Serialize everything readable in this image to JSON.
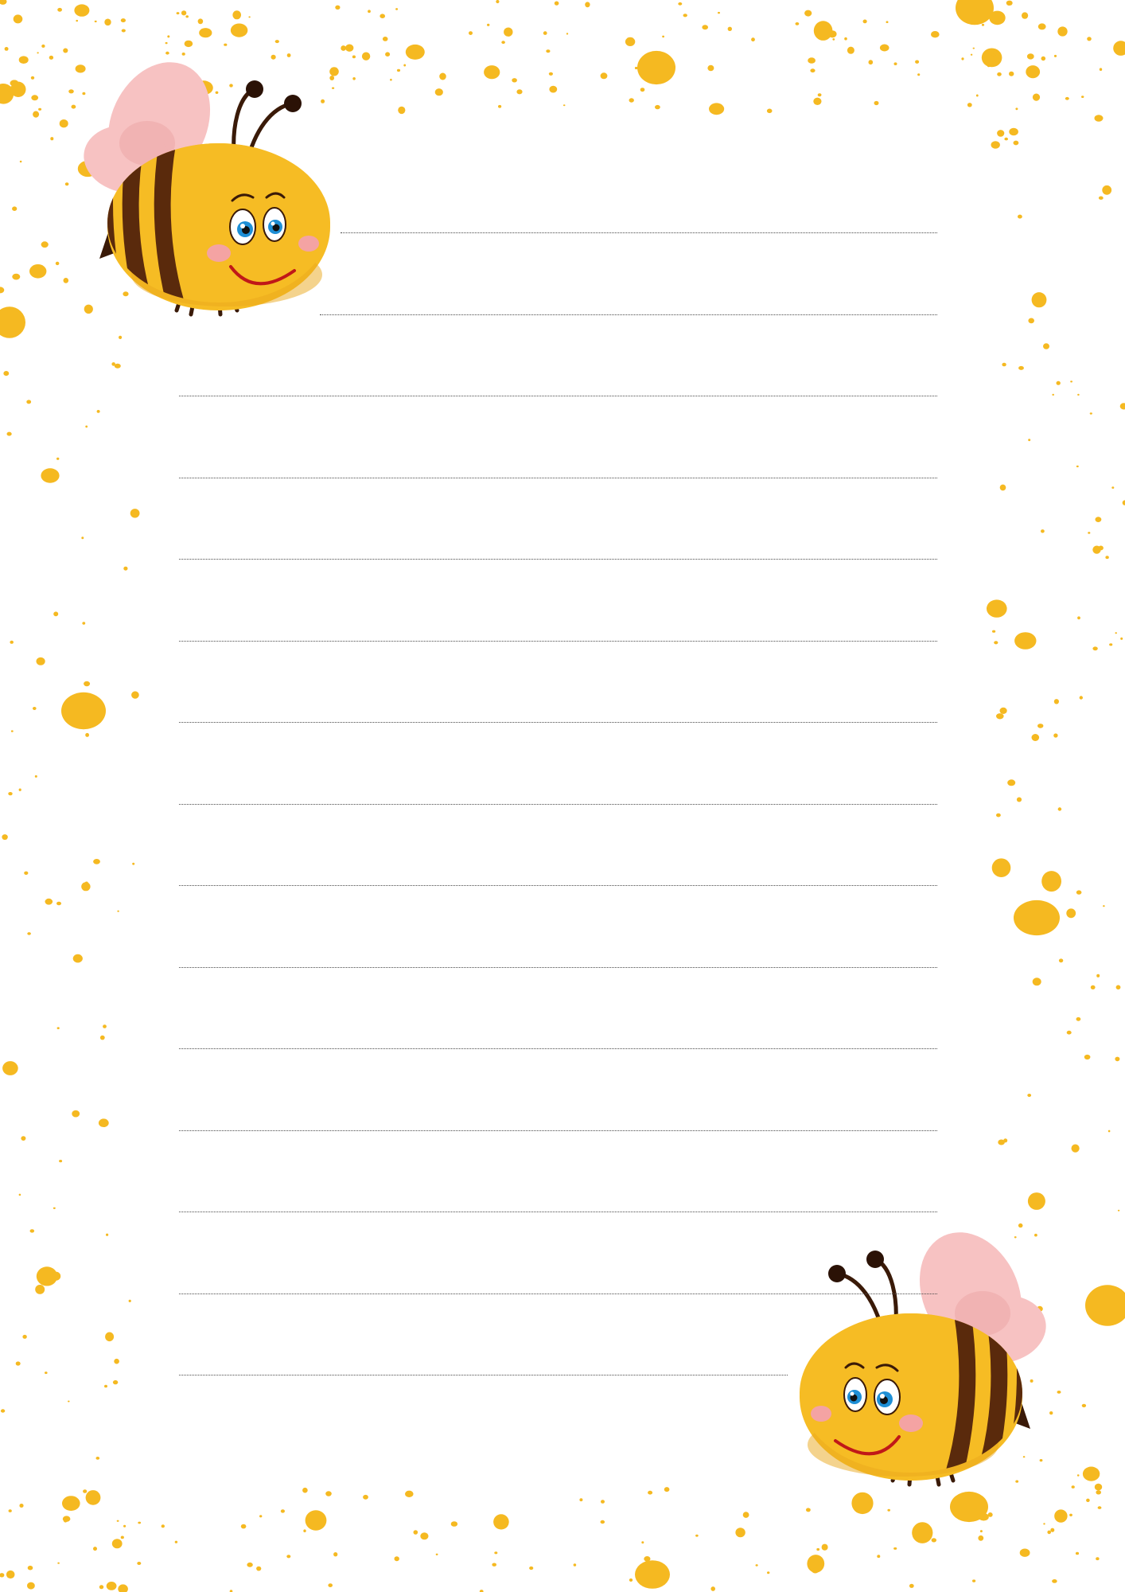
{
  "page": {
    "type": "lined-stationery",
    "theme": "bees",
    "background_color": "#ffffff"
  },
  "colors": {
    "accent_yellow": "#f5b921",
    "bee_body": "#f6bc24",
    "bee_stripe": "#5a2a0c",
    "wing_pink": "#f7c2c2",
    "line_color": "#4a4a4a"
  },
  "decorations": {
    "bee_count": 2,
    "icons": [
      "bee-icon",
      "bee-icon"
    ],
    "splatter": "yellow-dots"
  },
  "writing_lines": {
    "count": 15,
    "style": "dotted"
  }
}
